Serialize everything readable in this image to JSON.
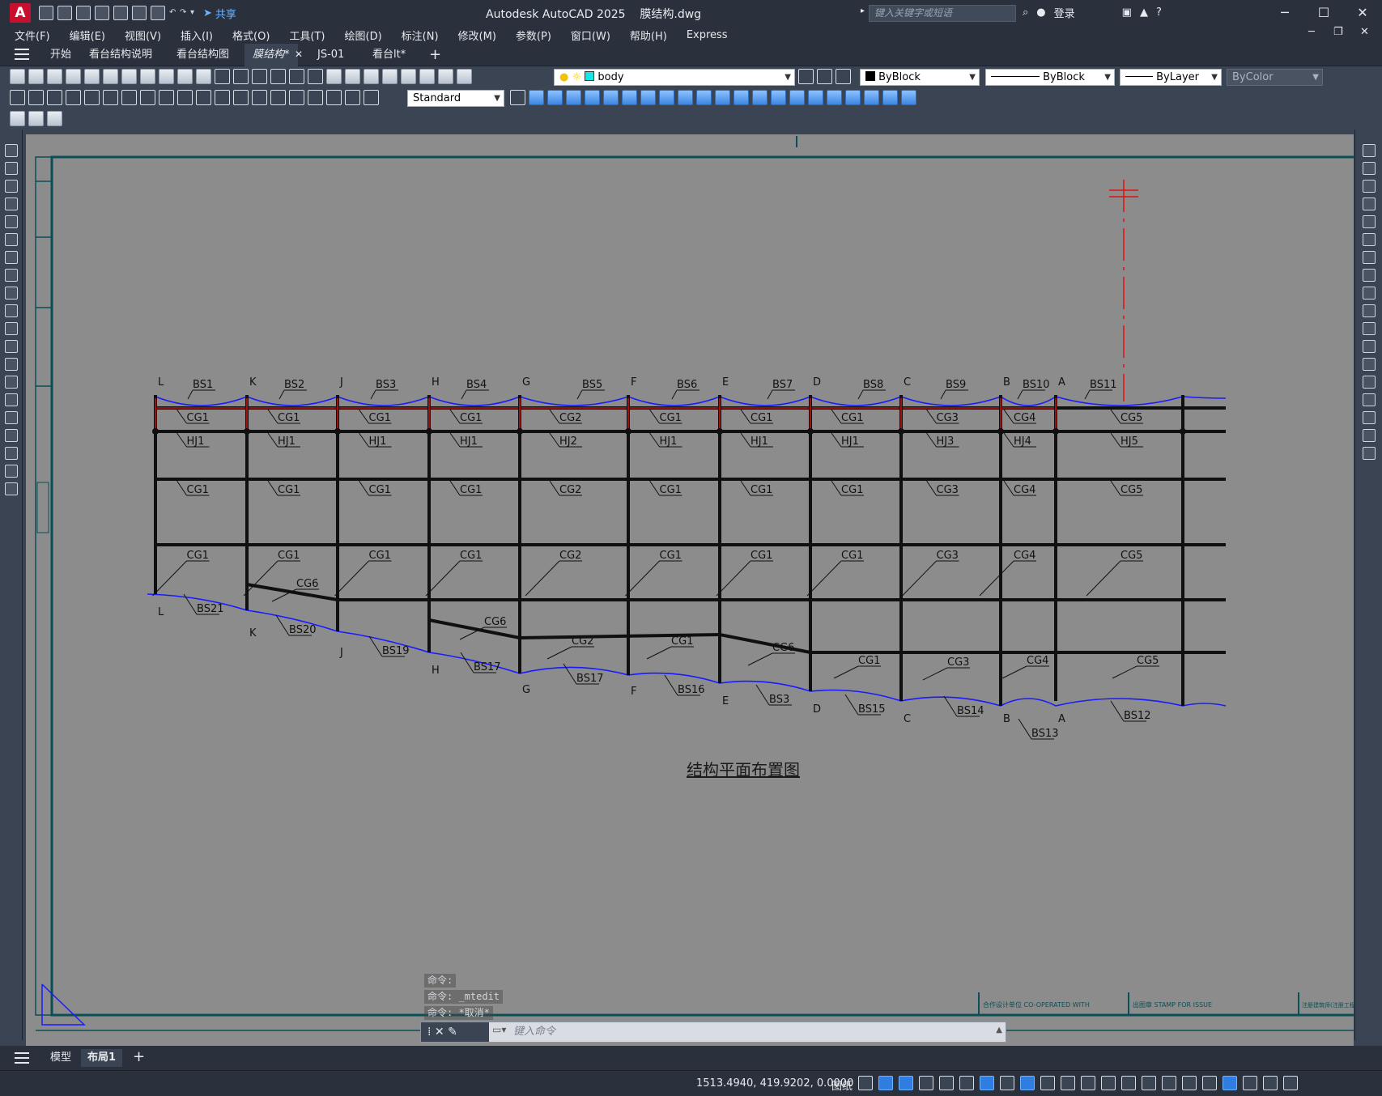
{
  "app": {
    "logo": "A",
    "title": "Autodesk AutoCAD 2025    膜结构.dwg",
    "share": "共享"
  },
  "search": {
    "placeholder": "键入关键字或短语"
  },
  "account": {
    "login": "登录"
  },
  "menu": [
    "文件(F)",
    "编辑(E)",
    "视图(V)",
    "插入(I)",
    "格式(O)",
    "工具(T)",
    "绘图(D)",
    "标注(N)",
    "修改(M)",
    "参数(P)",
    "窗口(W)",
    "帮助(H)",
    "Express"
  ],
  "doc_tabs": [
    "开始",
    "看台结构说明",
    "看台结构图",
    "膜结构*",
    "JS-01",
    "看台lt*"
  ],
  "layer_combo": "body",
  "color_combo": "ByBlock",
  "linetype_combo": "ByBlock",
  "lineweight_combo": "ByLayer",
  "plotstyle_combo": "ByColor",
  "dimstyle_combo": "Standard",
  "drawing": {
    "title": "结构平面布置图",
    "top_labels": [
      "BS1",
      "BS2",
      "BS3",
      "BS4",
      "BS5",
      "BS6",
      "BS7",
      "BS8",
      "BS9",
      "BS10",
      "BS11"
    ],
    "bottom_labels": [
      "BS21",
      "BS20",
      "BS19",
      "BS17",
      "BS17",
      "BS16",
      "BS3",
      "BS15",
      "BS14",
      "BS13",
      "BS12"
    ],
    "axis_top": [
      "L",
      "K",
      "J",
      "H",
      "G",
      "F",
      "E",
      "D",
      "C",
      "B",
      "A"
    ],
    "axis_bottom": [
      "L",
      "K",
      "J",
      "H",
      "G",
      "F",
      "E",
      "D",
      "C",
      "B",
      "A"
    ],
    "row1": [
      "CG1",
      "CG1",
      "CG1",
      "CG1",
      "CG2",
      "CG1",
      "CG1",
      "CG1",
      "CG3",
      "CG4",
      "CG5"
    ],
    "row_hj": [
      "HJ1",
      "HJ1",
      "HJ1",
      "HJ1",
      "HJ2",
      "HJ1",
      "HJ1",
      "HJ1",
      "HJ3",
      "HJ4",
      "HJ5"
    ],
    "row2": [
      "CG1",
      "CG1",
      "CG1",
      "CG1",
      "CG2",
      "CG1",
      "CG1",
      "CG1",
      "CG3",
      "CG4",
      "CG5"
    ],
    "row3": [
      "CG1",
      "CG1",
      "CG1",
      "CG1",
      "CG2",
      "CG1",
      "CG1",
      "CG1",
      "CG3",
      "CG4",
      "CG5"
    ],
    "row4": [
      "CG6",
      "CG6",
      "CG2",
      "CG1",
      "CG6",
      "CG1",
      "CG3",
      "CG4",
      "CG5"
    ],
    "stamp1": "合作设计单位 CO-OPERATED WITH",
    "stamp2": "出图章 STAMP FOR ISSUE",
    "stamp3": "注册建筑师(注册工程师) REGISTERED ARCHITECT"
  },
  "command": {
    "history": [
      "命令:",
      "命令: _mtedit",
      "命令: *取消*"
    ],
    "placeholder": "键入命令"
  },
  "layout_tabs": [
    "模型",
    "布局1"
  ],
  "status": {
    "coords": "1513.4940, 419.9202, 0.0000",
    "space": "图纸"
  },
  "colors": {
    "accent": "#2f7de1",
    "canvas": "#8c8c8c",
    "frame": "#0b4f56",
    "beam_blue": "#1a1aff",
    "red": "#e01010"
  }
}
